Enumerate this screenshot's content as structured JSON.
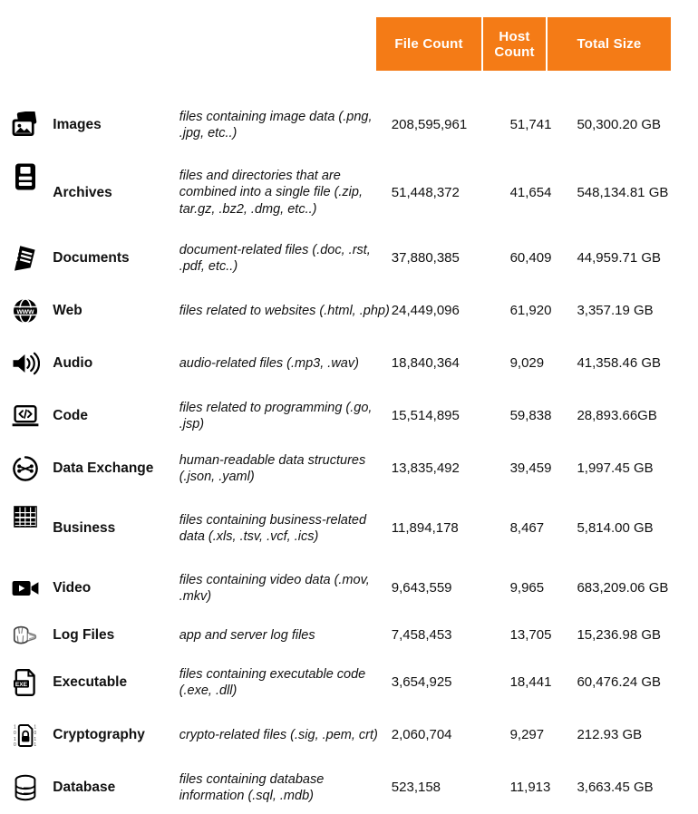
{
  "table": {
    "columns": {
      "icon": "",
      "category": "",
      "description": "",
      "file_count": "File Count",
      "host_count_line1": "Host",
      "host_count_line2": "Count",
      "total_size": "Total Size"
    },
    "header_bg": "#F47B16",
    "header_fg": "#FFFFFF",
    "rows": [
      {
        "icon": "images-icon",
        "category": "Images",
        "description": "files containing image data (.png, .jpg, etc..)",
        "file_count": "208,595,961",
        "host_count": "51,741",
        "total_size": "50,300.20 GB"
      },
      {
        "icon": "archives-icon",
        "category": "Archives",
        "description": "files and directories that are combined into a single file (.zip, tar.gz, .bz2, .dmg, etc..)",
        "file_count": "51,448,372",
        "host_count": "41,654",
        "total_size": "548,134.81 GB"
      },
      {
        "icon": "documents-icon",
        "category": "Documents",
        "description": "document-related files (.doc, .rst, .pdf, etc..)",
        "file_count": "37,880,385",
        "host_count": "60,409",
        "total_size": "44,959.71 GB"
      },
      {
        "icon": "web-icon",
        "category": "Web",
        "description": "files related to websites (.html, .php)",
        "file_count": "24,449,096",
        "host_count": "61,920",
        "total_size": "3,357.19 GB"
      },
      {
        "icon": "audio-icon",
        "category": "Audio",
        "description": "audio-related files (.mp3, .wav)",
        "file_count": "18,840,364",
        "host_count": "9,029",
        "total_size": "41,358.46 GB"
      },
      {
        "icon": "code-icon",
        "category": "Code",
        "description": "files related to programming (.go, .jsp)",
        "file_count": "15,514,895",
        "host_count": "59,838",
        "total_size": "28,893.66GB"
      },
      {
        "icon": "data-exchange-icon",
        "category": "Data Exchange",
        "description": "human-readable data structures (.json, .yaml)",
        "file_count": "13,835,492",
        "host_count": "39,459",
        "total_size": "1,997.45 GB"
      },
      {
        "icon": "business-icon",
        "category": "Business",
        "description": "files containing business-related data (.xls, .tsv, .vcf, .ics)",
        "file_count": "11,894,178",
        "host_count": "8,467",
        "total_size": "5,814.00 GB"
      },
      {
        "icon": "video-icon",
        "category": "Video",
        "description": "files containing video data (.mov, .mkv)",
        "file_count": "9,643,559",
        "host_count": "9,965",
        "total_size": "683,209.06 GB"
      },
      {
        "icon": "log-files-icon",
        "category": "Log Files",
        "description": "app and server log files",
        "file_count": "7,458,453",
        "host_count": "13,705",
        "total_size": "15,236.98 GB"
      },
      {
        "icon": "executable-icon",
        "category": "Executable",
        "description": "files containing executable code (.exe, .dll)",
        "file_count": "3,654,925",
        "host_count": "18,441",
        "total_size": "60,476.24 GB"
      },
      {
        "icon": "cryptography-icon",
        "category": "Cryptography",
        "description": "crypto-related files (.sig, .pem, crt)",
        "file_count": "2,060,704",
        "host_count": "9,297",
        "total_size": "212.93 GB"
      },
      {
        "icon": "database-icon",
        "category": "Database",
        "description": "files containing database information (.sql, .mdb)",
        "file_count": "523,158",
        "host_count": "11,913",
        "total_size": "3,663.45 GB"
      }
    ]
  }
}
